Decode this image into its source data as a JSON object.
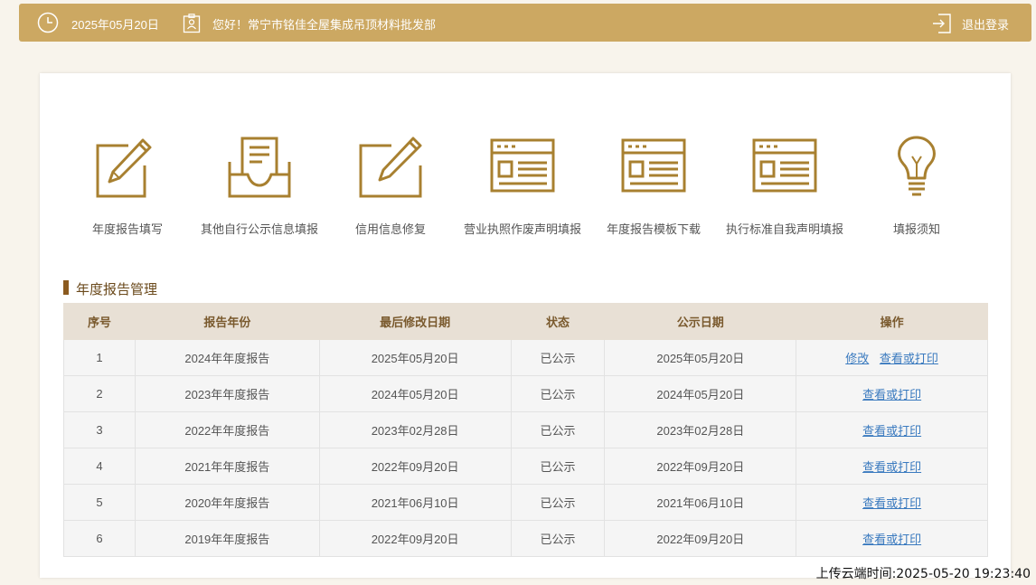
{
  "header": {
    "date": "2025年05月20日",
    "greeting": "您好！常宁市铭佳全屋集成吊顶材料批发部",
    "logout_label": "退出登录"
  },
  "menu": [
    {
      "label": "年度报告填写",
      "icon": "pencil-edit-icon"
    },
    {
      "label": "其他自行公示信息填报",
      "icon": "inbox-document-icon"
    },
    {
      "label": "信用信息修复",
      "icon": "pencil-edit-icon"
    },
    {
      "label": "营业执照作废声明填报",
      "icon": "browser-window-icon"
    },
    {
      "label": "年度报告模板下载",
      "icon": "browser-window-icon"
    },
    {
      "label": "执行标准自我声明填报",
      "icon": "browser-window-icon"
    },
    {
      "label": "填报须知",
      "icon": "lightbulb-icon"
    }
  ],
  "section_title": "年度报告管理",
  "table": {
    "headers": [
      "序号",
      "报告年份",
      "最后修改日期",
      "状态",
      "公示日期",
      "操作"
    ],
    "rows": [
      {
        "no": "1",
        "year": "2024年年度报告",
        "modified": "2025年05月20日",
        "status": "已公示",
        "published": "2025年05月20日",
        "edit": "修改",
        "view": "查看或打印"
      },
      {
        "no": "2",
        "year": "2023年年度报告",
        "modified": "2024年05月20日",
        "status": "已公示",
        "published": "2024年05月20日",
        "view": "查看或打印"
      },
      {
        "no": "3",
        "year": "2022年年度报告",
        "modified": "2023年02月28日",
        "status": "已公示",
        "published": "2023年02月28日",
        "view": "查看或打印"
      },
      {
        "no": "4",
        "year": "2021年年度报告",
        "modified": "2022年09月20日",
        "status": "已公示",
        "published": "2022年09月20日",
        "view": "查看或打印"
      },
      {
        "no": "5",
        "year": "2020年年度报告",
        "modified": "2021年06月10日",
        "status": "已公示",
        "published": "2021年06月10日",
        "view": "查看或打印"
      },
      {
        "no": "6",
        "year": "2019年年度报告",
        "modified": "2022年09月20日",
        "status": "已公示",
        "published": "2022年09月20日",
        "view": "查看或打印"
      }
    ]
  },
  "upload_time": "上传云端时间:2025-05-20 19:23:40",
  "colors": {
    "header_bg": "#cca862",
    "icon": "#a88030",
    "link": "#3a7abf"
  }
}
